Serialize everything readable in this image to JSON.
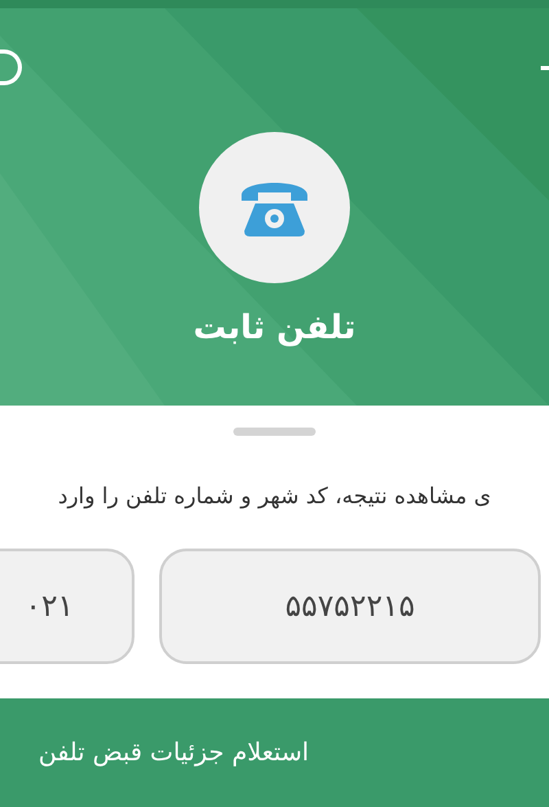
{
  "header": {
    "title": "تلفن ثابت"
  },
  "prompt": "ی مشاهده نتیجه، کد شهر و شماره تلفن را وارد",
  "fields": [
    {
      "kind": "phone",
      "value": "۵۵۷۵۲۲۱۵"
    },
    {
      "kind": "code",
      "value": "۰۲۱"
    }
  ],
  "submit_button": "استعلام جزئیات قبض تلفن"
}
